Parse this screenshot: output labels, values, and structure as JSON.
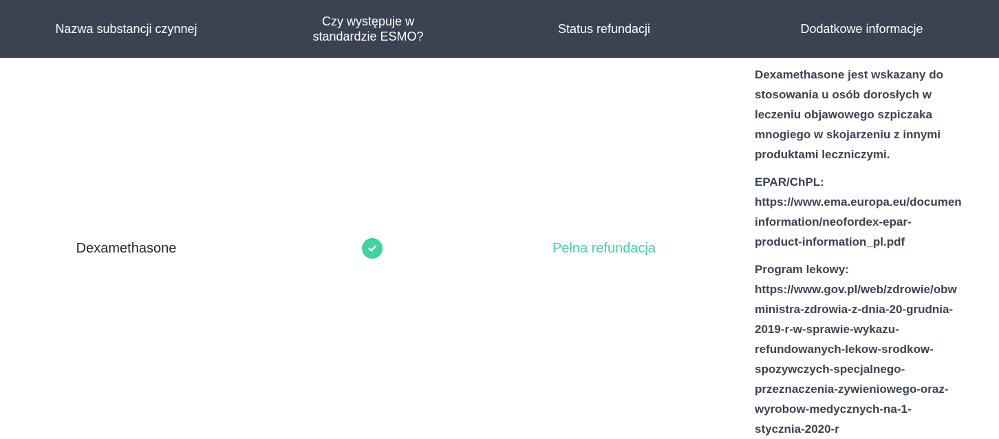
{
  "table": {
    "headers": [
      "Nazwa substancji czynnej",
      "Czy występuje w\nstandardzie ESMO?",
      "Status refundacji",
      "Dodatkowe informacje"
    ],
    "row": {
      "name": "Dexamethasone",
      "esmo_icon": "check-circle-icon",
      "esmo": true,
      "status": "Pełna refundacja",
      "info": {
        "description": "Dexamethasone jest wskazany do\nstosowania u osób dorosłych w\nleczeniu objawowego szpiczaka\nmnogiego w skojarzeniu z innymi\nproduktami leczniczymi.",
        "epar_label": "EPAR/ChPL:",
        "epar_link": "https://www.ema.europa.eu/documen\ninformation/neofordex-epar-\nproduct-information_pl.pdf",
        "program_label": "Program lekowy:",
        "program_link": "https://www.gov.pl/web/zdrowie/obw\nministra-zdrowia-z-dnia-20-grudnia-\n2019-r-w-sprawie-wykazu-\nrefundowanych-lekow-srodkow-\nspozywczych-specjalnego-\nprzeznaczenia-zywieniowego-oraz-\nwyrobow-medycznych-na-1-\nstycznia-2020-r"
      }
    }
  },
  "colors": {
    "header_bg": "#3b4251",
    "header_text": "#ffffff",
    "accent_green": "#3fd3a0",
    "body_text": "#3b4251"
  }
}
